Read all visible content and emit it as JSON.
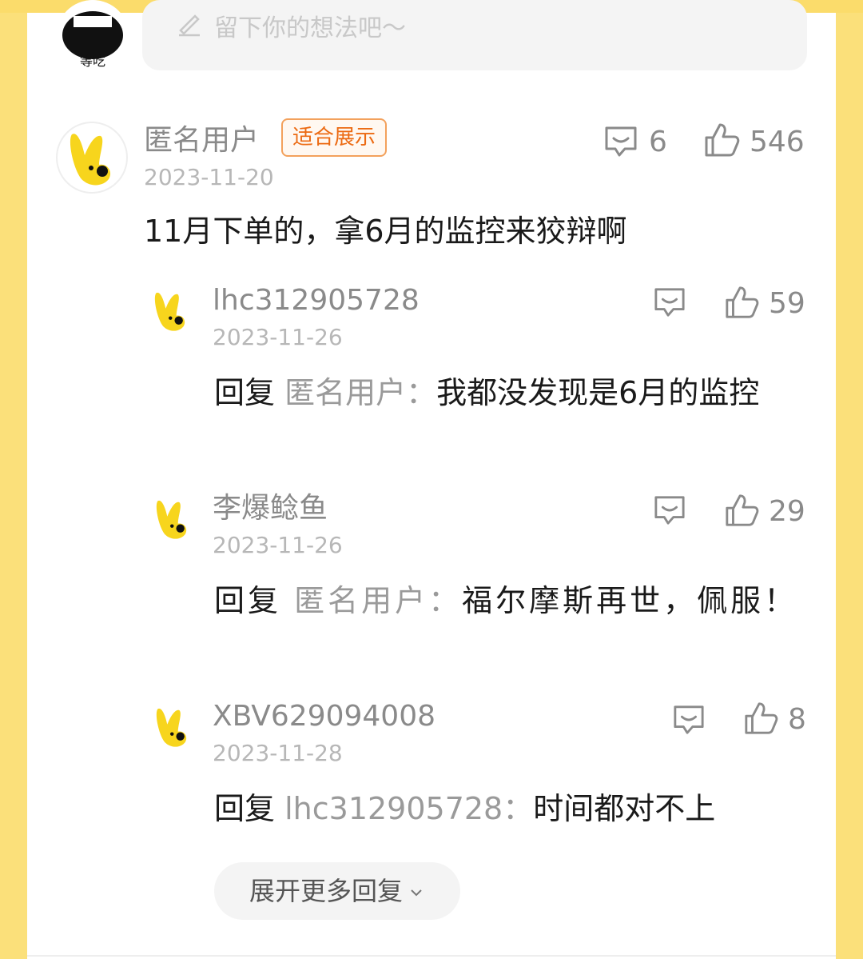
{
  "input": {
    "placeholder": "留下你的想法吧～",
    "avatar_caption": "等吃"
  },
  "main_comment": {
    "username": "匿名用户",
    "badge": "适合展示",
    "date": "2023-11-20",
    "text": "11月下单的，拿6月的监控来狡辩啊",
    "comment_count": "6",
    "like_count": "546"
  },
  "replies": [
    {
      "username": "lhc312905728",
      "date": "2023-11-26",
      "reply_label": "回复",
      "reply_to": "匿名用户",
      "colon": "：",
      "text": "我都没发现是6月的监控",
      "like_count": "59"
    },
    {
      "username": "李爆鲶鱼",
      "date": "2023-11-26",
      "reply_label": "回复",
      "reply_to": "匿名用户",
      "colon": "：",
      "text": "福尔摩斯再世，佩服！",
      "like_count": "29"
    },
    {
      "username": "XBV629094008",
      "date": "2023-11-28",
      "reply_label": "回复",
      "reply_to": "lhc312905728",
      "colon": "：",
      "text": "时间都对不上",
      "like_count": "8"
    }
  ],
  "expand_label": "展开更多回复",
  "icons": {
    "comment": "comment-bubble-icon",
    "like": "thumbs-up-icon",
    "expand": "chevron-down-icon",
    "write": "pencil-icon"
  },
  "colors": {
    "accent_yellow": "#fbe07a",
    "badge_orange": "#ec6a12",
    "mascot_yellow": "#f7d51d"
  }
}
